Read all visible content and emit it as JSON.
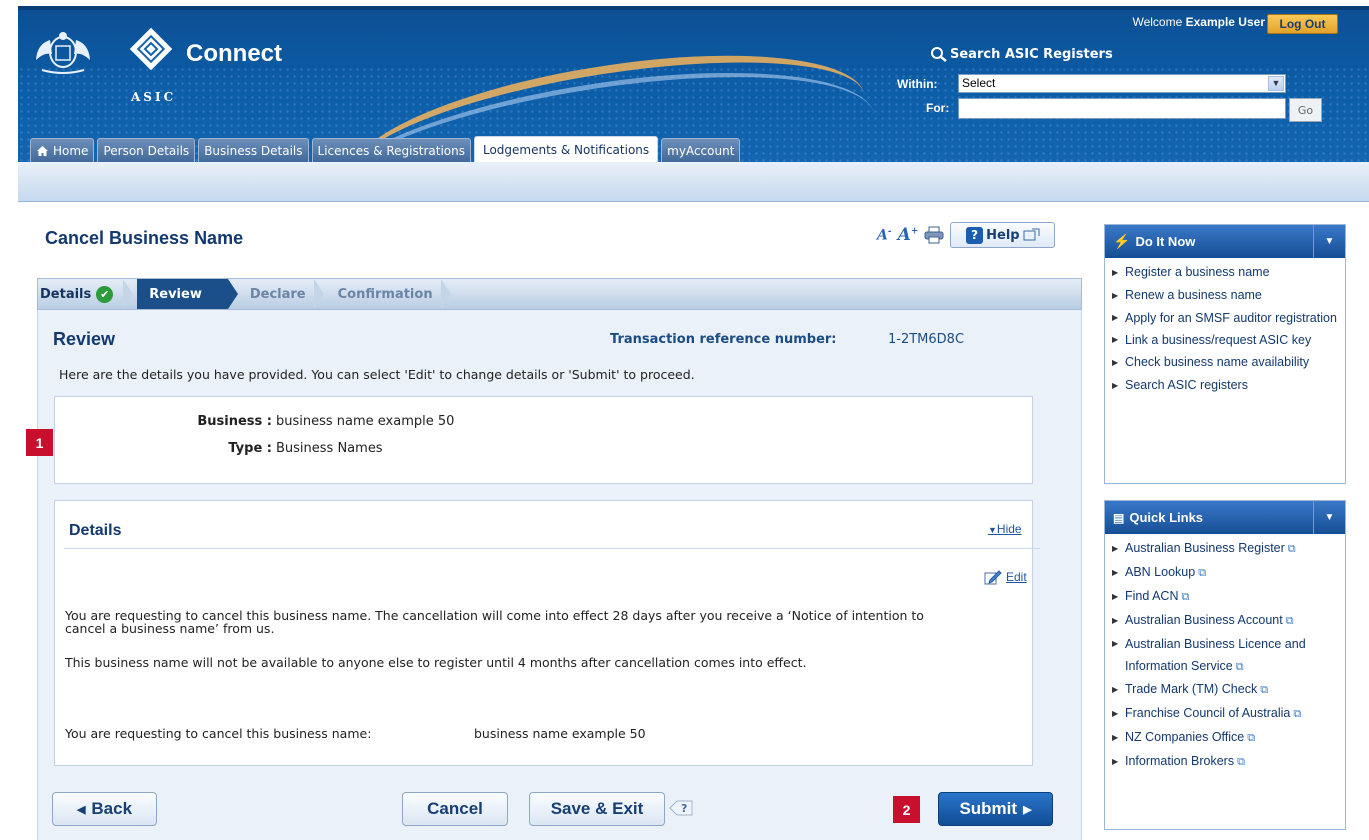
{
  "header": {
    "agency": "ASIC",
    "brand": "Connect",
    "welcome_prefix": "Welcome",
    "user_name": "Example User",
    "logout_label": "Log Out",
    "search_title": "Search ASIC Registers",
    "within_label": "Within:",
    "within_value": "Select",
    "for_label": "For:",
    "for_value": "",
    "go_label": "Go"
  },
  "tabs": [
    {
      "label": "Home",
      "active": false
    },
    {
      "label": "Person Details",
      "active": false
    },
    {
      "label": "Business Details",
      "active": false
    },
    {
      "label": "Licences & Registrations",
      "active": false
    },
    {
      "label": "Lodgements & Notifications",
      "active": true
    },
    {
      "label": "myAccount",
      "active": false
    }
  ],
  "page": {
    "title": "Cancel Business Name",
    "help_label": "Help"
  },
  "steps": [
    {
      "label": "Details",
      "state": "complete"
    },
    {
      "label": "Review",
      "state": "current"
    },
    {
      "label": "Declare",
      "state": "upcoming"
    },
    {
      "label": "Confirmation",
      "state": "upcoming"
    }
  ],
  "review": {
    "title": "Review",
    "trn_label": "Transaction reference number:",
    "trn_value": "1-2TM6D8C",
    "intro": "Here are the details you have provided. You can select 'Edit' to change details or 'Submit' to proceed.",
    "business_label": "Business :",
    "business_value": "business name example 50",
    "type_label": "Type :",
    "type_value": "Business Names"
  },
  "details": {
    "heading": "Details",
    "hide_label": "Hide",
    "edit_label": "Edit",
    "para1": "You are requesting to cancel this business name. The cancellation will come into effect 28 days after you receive a ‘Notice of intention to cancel a business name’ from us.",
    "para2": "This business name will not be available to anyone else to register until 4 months after cancellation comes into effect.",
    "request_label": "You are requesting to cancel this business name:",
    "request_value": "business name example 50"
  },
  "buttons": {
    "back": "Back",
    "cancel": "Cancel",
    "save_exit": "Save & Exit",
    "submit": "Submit"
  },
  "badges": {
    "one": "1",
    "two": "2"
  },
  "do_it_now": {
    "title": "Do It Now",
    "items": [
      "Register a business name",
      "Renew a business name",
      "Apply for an SMSF auditor registration",
      "Link a business/request ASIC key",
      "Check business name availability",
      "Search ASIC registers"
    ]
  },
  "quick_links": {
    "title": "Quick Links",
    "items": [
      "Australian Business Register",
      "ABN Lookup",
      "Find ACN",
      "Australian Business Account",
      "Australian Business Licence and Information Service",
      "Trade Mark (TM) Check",
      "Franchise Council of Australia",
      "NZ Companies Office",
      "Information Brokers"
    ]
  },
  "colors": {
    "header_blue": "#0d5ea9",
    "title_navy": "#13396e",
    "badge_red": "#c8102e",
    "logout_gold": "#f0b43a",
    "submit_blue": "#1a5fb0"
  }
}
